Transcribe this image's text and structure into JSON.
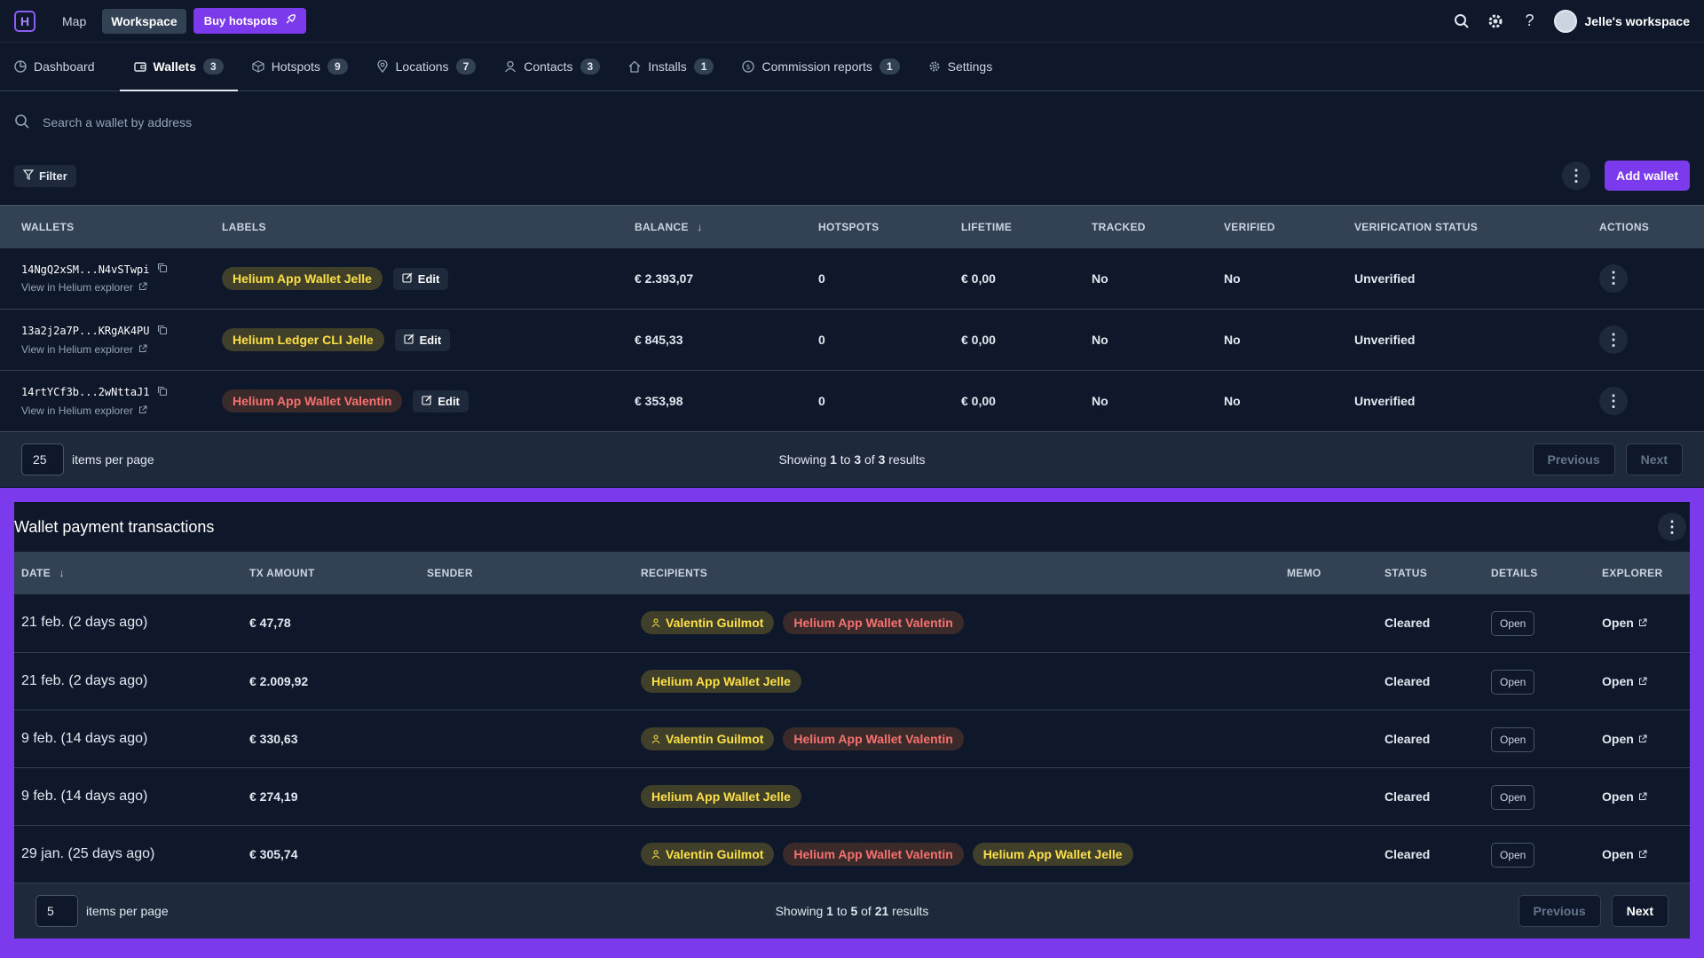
{
  "topbar": {
    "logo": "H",
    "nav": [
      "Map",
      "Workspace"
    ],
    "buy_label": "Buy hotspots",
    "workspace_name": "Jelle's workspace"
  },
  "tabs": [
    {
      "label": "Dashboard",
      "icon": "pie-chart-icon",
      "count": null
    },
    {
      "label": "Wallets",
      "icon": "wallet-icon",
      "count": "3",
      "active": true
    },
    {
      "label": "Hotspots",
      "icon": "cube-icon",
      "count": "9"
    },
    {
      "label": "Locations",
      "icon": "map-pin-icon",
      "count": "7"
    },
    {
      "label": "Contacts",
      "icon": "user-icon",
      "count": "3"
    },
    {
      "label": "Installs",
      "icon": "home-icon",
      "count": "1"
    },
    {
      "label": "Commission reports",
      "icon": "dollar-icon",
      "count": "1"
    },
    {
      "label": "Settings",
      "icon": "gear-icon",
      "count": null
    }
  ],
  "search": {
    "placeholder": "Search a wallet by address"
  },
  "filter_label": "Filter",
  "add_wallet_label": "Add wallet",
  "wallets": {
    "headers": [
      "Wallets",
      "Labels",
      "Balance",
      "Hotspots",
      "Lifetime",
      "Tracked",
      "Verified",
      "Verification status",
      "Actions"
    ],
    "rows": [
      {
        "address": "14NgQ2xSM...N4vSTwpi",
        "explorer": "View in Helium explorer",
        "label": "Helium App Wallet Jelle",
        "label_color": "yellow",
        "balance": "€ 2.393,07",
        "hotspots": "0",
        "lifetime": "€ 0,00",
        "tracked": "No",
        "verified": "No",
        "status": "Unverified"
      },
      {
        "address": "13a2j2a7P...KRgAK4PU",
        "explorer": "View in Helium explorer",
        "label": "Helium Ledger CLI Jelle",
        "label_color": "yellow",
        "balance": "€ 845,33",
        "hotspots": "0",
        "lifetime": "€ 0,00",
        "tracked": "No",
        "verified": "No",
        "status": "Unverified"
      },
      {
        "address": "14rtYCf3b...2wNttaJ1",
        "explorer": "View in Helium explorer",
        "label": "Helium App Wallet Valentin",
        "label_color": "red",
        "balance": "€ 353,98",
        "hotspots": "0",
        "lifetime": "€ 0,00",
        "tracked": "No",
        "verified": "No",
        "status": "Unverified"
      }
    ],
    "edit_label": "Edit",
    "pager": {
      "per_page": "25",
      "per_page_label": "items per page",
      "showing_prefix": "Showing",
      "from": "1",
      "to_word": "to",
      "to": "3",
      "of_word": "of",
      "total": "3",
      "results_word": "results",
      "previous": "Previous",
      "next": "Next"
    }
  },
  "transactions": {
    "title": "Wallet payment transactions",
    "headers": [
      "Date",
      "TX Amount",
      "Sender",
      "Recipients",
      "Memo",
      "Status",
      "Details",
      "Explorer"
    ],
    "rows": [
      {
        "date": "21 feb. (2 days ago)",
        "amount": "€ 47,78",
        "recipients": [
          {
            "text": "Valentin Guilmot",
            "color": "yellow",
            "contact": true
          },
          {
            "text": "Helium App Wallet Valentin",
            "color": "red"
          }
        ],
        "status": "Cleared",
        "details": "Open",
        "explorer": "Open"
      },
      {
        "date": "21 feb. (2 days ago)",
        "amount": "€ 2.009,92",
        "recipients": [
          {
            "text": "Helium App Wallet Jelle",
            "color": "yellow"
          }
        ],
        "status": "Cleared",
        "details": "Open",
        "explorer": "Open"
      },
      {
        "date": "9 feb. (14 days ago)",
        "amount": "€ 330,63",
        "recipients": [
          {
            "text": "Valentin Guilmot",
            "color": "yellow",
            "contact": true
          },
          {
            "text": "Helium App Wallet Valentin",
            "color": "red"
          }
        ],
        "status": "Cleared",
        "details": "Open",
        "explorer": "Open"
      },
      {
        "date": "9 feb. (14 days ago)",
        "amount": "€ 274,19",
        "recipients": [
          {
            "text": "Helium App Wallet Jelle",
            "color": "yellow"
          }
        ],
        "status": "Cleared",
        "details": "Open",
        "explorer": "Open"
      },
      {
        "date": "29 jan. (25 days ago)",
        "amount": "€ 305,74",
        "recipients": [
          {
            "text": "Valentin Guilmot",
            "color": "yellow",
            "contact": true
          },
          {
            "text": "Helium App Wallet Valentin",
            "color": "red"
          },
          {
            "text": "Helium App Wallet Jelle",
            "color": "yellow"
          }
        ],
        "status": "Cleared",
        "details": "Open",
        "explorer": "Open"
      }
    ],
    "pager": {
      "per_page": "5",
      "per_page_label": "items per page",
      "showing_prefix": "Showing",
      "from": "1",
      "to_word": "to",
      "to": "5",
      "of_word": "of",
      "total": "21",
      "results_word": "results",
      "previous": "Previous",
      "next": "Next"
    }
  },
  "colors": {
    "accent": "#7c3aed",
    "background": "#0f172a",
    "header_bg": "#334155",
    "pill_yellow_text": "#fde047",
    "pill_red_text": "#f87171"
  }
}
